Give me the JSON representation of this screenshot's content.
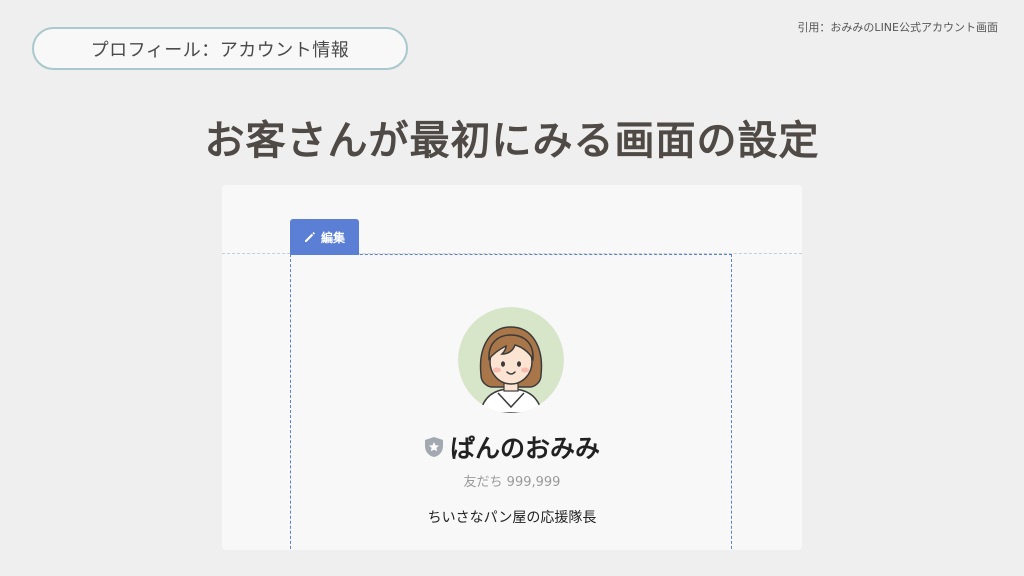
{
  "section_label": "プロフィール：アカウント情報",
  "source_note": "引用：おみみのLINE公式アカウント画面",
  "headline": "お客さんが最初にみる画面の設定",
  "profile_card": {
    "edit_label": "編集",
    "edit_icon": "pencil-icon",
    "badge_icon": "shield-star-icon",
    "account_name": "ぱんのおみみ",
    "friends_text": "友だち 999,999",
    "bio": "ちいさなパン屋の応援隊長"
  },
  "colors": {
    "background": "#efefef",
    "card": "#f8f8f8",
    "accent_blue": "#5b7fd5",
    "pill_border": "#a9c9cd",
    "headline": "#4f4a45",
    "avatar_bg": "#d7e6c9"
  }
}
